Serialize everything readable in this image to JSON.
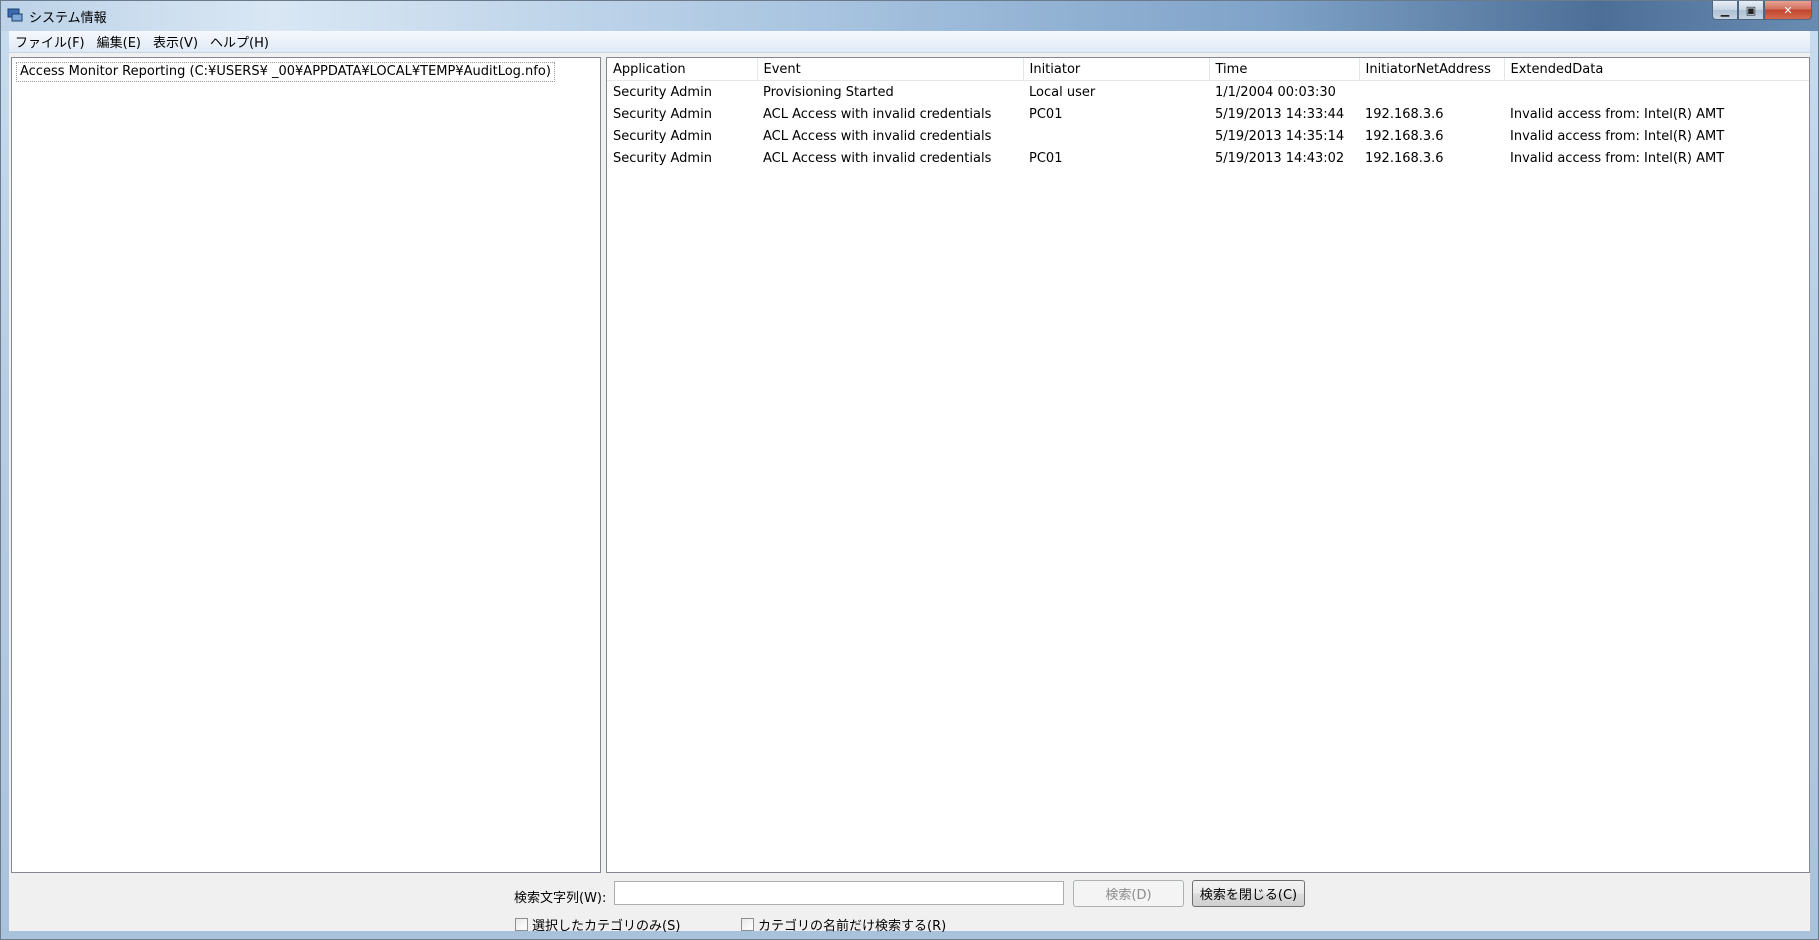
{
  "window": {
    "title": "システム情報"
  },
  "menu": [
    "ファイル(F)",
    "編集(E)",
    "表示(V)",
    "ヘルプ(H)"
  ],
  "tree": {
    "item": "Access Monitor Reporting (C:¥USERS¥              _00¥APPDATA¥LOCAL¥TEMP¥AuditLog.nfo)"
  },
  "table": {
    "columns": [
      "Application",
      "Event",
      "Initiator",
      "Time",
      "InitiatorNetAddress",
      "ExtendedData"
    ],
    "rows": [
      [
        "Security Admin",
        "Provisioning Started",
        "Local user",
        "1/1/2004 00:03:30",
        "",
        ""
      ],
      [
        "Security Admin",
        "ACL Access with invalid credentials",
        "PC01",
        "5/19/2013 14:33:44",
        "192.168.3.6",
        "Invalid access from: Intel(R) AMT"
      ],
      [
        "Security Admin",
        "ACL Access with invalid credentials",
        "",
        "5/19/2013 14:35:14",
        "192.168.3.6",
        "Invalid access from: Intel(R) AMT"
      ],
      [
        "Security Admin",
        "ACL Access with invalid credentials",
        "PC01",
        "5/19/2013 14:43:02",
        "192.168.3.6",
        "Invalid access from: Intel(R) AMT"
      ]
    ]
  },
  "search": {
    "label": "検索文字列(W):",
    "value": "",
    "find_button": "検索(D)",
    "close_button": "検索を閉じる(C)",
    "option_selected_only": "選択したカテゴリのみ(S)",
    "option_category_names": "カテゴリの名前だけ検索する(R)"
  },
  "icons": {
    "app": "system-info-icon",
    "minimize": "minimize-icon",
    "maximize": "maximize-icon",
    "close": "close-icon"
  }
}
